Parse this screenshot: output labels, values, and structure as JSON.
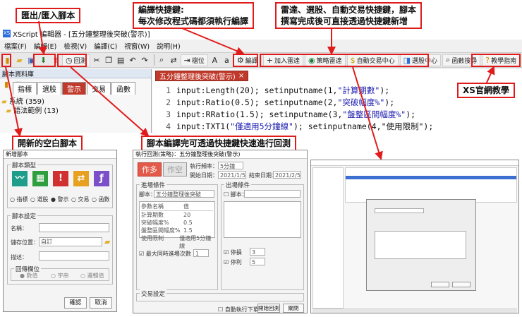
{
  "window": {
    "title": "XScript 編輯器 - [五分鐘整理後突破(警示)]",
    "app_icon": "XS"
  },
  "menu": [
    "檔案(F)",
    "編輯(E)",
    "檢視(V)",
    "編譯(C)",
    "視窗(W)",
    "說明(H)"
  ],
  "toolbar": {
    "backtest": "回測",
    "indent": "檔位",
    "compile": "編譯",
    "add_radar": "加入雷達",
    "strategy_radar": "策略雷達",
    "auto_trade": "自動交易中心",
    "screener": "選股中心",
    "function_search": "函數搜尋",
    "teaching": "教學指南"
  },
  "left_panel": {
    "title": "腳本資料庫",
    "tabs": [
      "指標",
      "選股",
      "警示",
      "交易",
      "函數"
    ],
    "active_tab": "警示",
    "tree": [
      "系統 (359)",
      "語法範例 (13)"
    ]
  },
  "editor": {
    "doc_tab": "五分鐘整理後突破(警示)",
    "lines": [
      {
        "n": "1",
        "pre": "input:Length(20); setinputname(1,",
        "str": "\"計算期數\"",
        "post": ");"
      },
      {
        "n": "2",
        "pre": "input:Ratio(0.5); setinputname(2,",
        "str": "\"突破幅度%\"",
        "post": ");"
      },
      {
        "n": "3",
        "pre": "input:RRatio(1.5); setinputname(3,",
        "str": "\"盤整區間幅度%\"",
        "post": ");"
      },
      {
        "n": "4",
        "pre": "input:TXT1(",
        "str": "\"僅適用5分鐘線\"",
        "post": "); setinputname(4,\"使用限制\");"
      }
    ]
  },
  "callouts": {
    "import_export": "匯出/匯入腳本",
    "compile_hotkey_1": "編譯快捷鍵:",
    "compile_hotkey_2": "每次修改程式碼都須執行編譯",
    "radar_1": "雷達、選股、自動交易快捷鍵，腳本",
    "radar_2": "撰寫完成後可直接透過快捷鍵新增",
    "xs_teaching": "XS官網教學",
    "new_blank": "開新的空白腳本",
    "backtest": "腳本編譯完可透過快捷鍵快速進行回測"
  },
  "new_script_dialog": {
    "title": "新增腳本",
    "type_group": "腳本類型",
    "types": [
      "指標",
      "選股",
      "警示",
      "交易",
      "函數"
    ],
    "settings_group": "腳本設定",
    "name_label": "名稱：",
    "location_label": "儲存位置：",
    "location_value": "自訂",
    "desc_label": "描述：",
    "return_group": "回傳欄位",
    "return_types": [
      "數值",
      "字串",
      "邏輯值"
    ],
    "ok": "確認",
    "cancel": "取消"
  },
  "backtest_dialog": {
    "title": "執行回測(策略)：五分鐘整理後突破(警示)",
    "tabs": [
      "作多",
      "作空"
    ],
    "period_label": "執行頻率：",
    "period_value": "5分鐘",
    "start_label": "開始日期：",
    "start_value": "2021/1/5",
    "end_label": "結束日期：",
    "end_value": "2021/2/5",
    "entry_group": "進場條件",
    "exit_group": "出場條件",
    "script_label": "腳本：",
    "script_value": "五分鐘整理後突破",
    "param_header": [
      "參數名稱",
      "值"
    ],
    "params": [
      [
        "計算期數",
        "20"
      ],
      [
        "突破幅度%",
        "0.5"
      ],
      [
        "盤整區間幅度%",
        "1.5"
      ],
      [
        "使用限制",
        "僅適用5分鐘線"
      ]
    ],
    "stop_loss": "停損",
    "take_profit": "停利",
    "max_entries": "最大同時進場次數",
    "trade_group": "交易設定",
    "auto_exec": "自動執行下單",
    "start_btn": "開始回測",
    "close_btn": "關閉"
  }
}
